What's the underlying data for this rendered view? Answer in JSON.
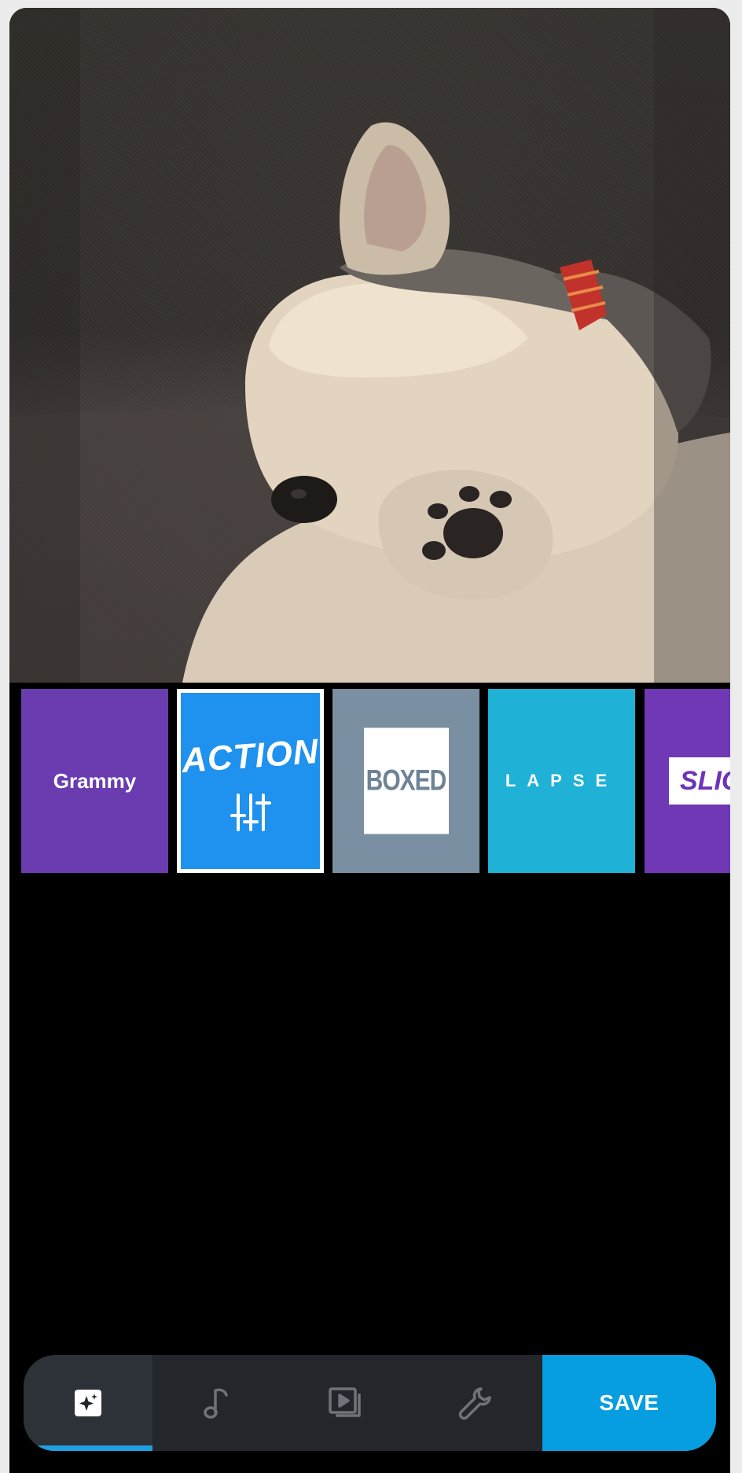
{
  "filters": [
    {
      "label": "Grammy",
      "color": "#6a3cb0",
      "selected": false
    },
    {
      "label": "ACTION",
      "color": "#1f91ee",
      "selected": true,
      "icon": "sliders-icon"
    },
    {
      "label": "BOXED",
      "color": "#7a8fa1",
      "selected": false
    },
    {
      "label": "LAPSE",
      "color": "#1fb1d6",
      "selected": false
    },
    {
      "label": "SLIC",
      "color": "#7038b5",
      "selected": false
    }
  ],
  "toolbar": {
    "tabs": [
      {
        "name": "themes",
        "icon": "sparkle-icon",
        "active": true
      },
      {
        "name": "music",
        "icon": "music-note-icon",
        "active": false
      },
      {
        "name": "clips",
        "icon": "video-clips-icon",
        "active": false
      },
      {
        "name": "settings",
        "icon": "wrench-icon",
        "active": false
      }
    ],
    "save_label": "SAVE"
  },
  "colors": {
    "accent": "#1ea0e4",
    "save": "#069ee0",
    "bar": "#23262b"
  }
}
